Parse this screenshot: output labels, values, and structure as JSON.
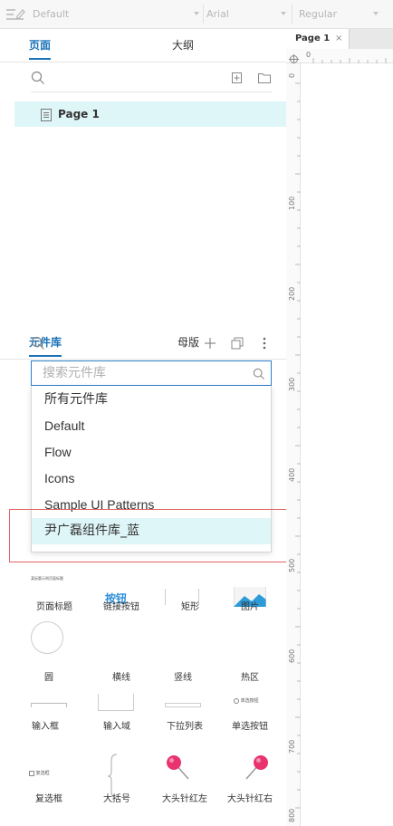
{
  "toolbar": {
    "style_value": "Default",
    "font_value": "Arial",
    "weight_value": "Regular"
  },
  "pages_panel": {
    "tabs": [
      {
        "label": "页面",
        "active": true
      },
      {
        "label": "大纲",
        "active": false
      }
    ],
    "pages": [
      {
        "label": "Page 1",
        "selected": true
      }
    ]
  },
  "library_panel": {
    "tabs": [
      {
        "label": "元件库",
        "active": true
      },
      {
        "label": "母版",
        "active": false
      }
    ],
    "search_placeholder": "搜索元件库",
    "dropdown_options": [
      {
        "label": "所有元件库"
      },
      {
        "label": "Default"
      },
      {
        "label": "Flow"
      },
      {
        "label": "Icons"
      },
      {
        "label": "Sample UI Patterns"
      },
      {
        "label": "尹广磊组件库_蓝",
        "selected": true
      }
    ],
    "thumb_texts": {
      "page_title_sample": "某标题示例页面标题",
      "link_button_sample": "按钮",
      "radio_sample": "单选按钮",
      "checkbox_sample": "复选框"
    },
    "widgets": [
      {
        "label": "页面标题"
      },
      {
        "label": "链接按钮"
      },
      {
        "label": "矩形"
      },
      {
        "label": "图片"
      },
      {
        "label": "圆"
      },
      {
        "label": "横线"
      },
      {
        "label": "竖线"
      },
      {
        "label": "热区"
      },
      {
        "label": "输入框"
      },
      {
        "label": "输入域"
      },
      {
        "label": "下拉列表"
      },
      {
        "label": "单选按钮"
      },
      {
        "label": "复选框"
      },
      {
        "label": "大括号"
      },
      {
        "label": "大头针红左"
      },
      {
        "label": "大头针红右"
      }
    ]
  },
  "canvas": {
    "doc_tab": {
      "label": "Page 1",
      "close": "×"
    },
    "hruler_origin": "0",
    "vruler_labels": [
      "0",
      "100",
      "200",
      "300",
      "400",
      "500",
      "600",
      "700",
      "800"
    ]
  },
  "colors": {
    "accent": "#1a73b8",
    "selection_bg": "#dff6f8",
    "highlight_border": "#e06666",
    "pin_red": "#e8336e"
  }
}
